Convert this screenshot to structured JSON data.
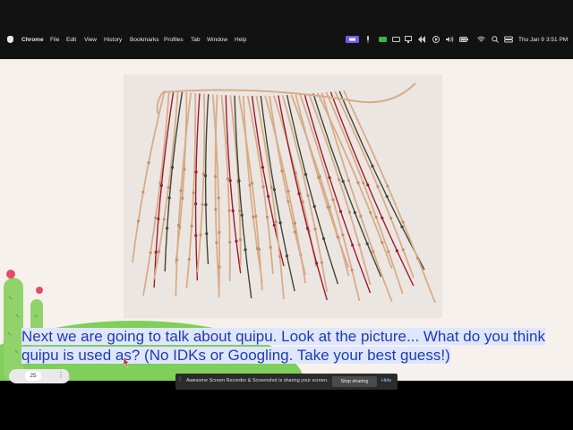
{
  "menubar": {
    "app": "Chrome",
    "items": [
      "File",
      "Edit",
      "View",
      "History",
      "Bookmarks",
      "Profiles",
      "Tab",
      "Window",
      "Help"
    ],
    "date": "Thu Jan 9",
    "time": "3:51 PM"
  },
  "slide": {
    "caption": "Next we are going to talk about quipu. Look at the picture... What do you think quipu is used as? (No IDKs or Googling. Take your best guess!)"
  },
  "page_indicator": {
    "number": "25"
  },
  "share_bar": {
    "message": "Awesome Screen Recorder & Screenshot is sharing your screen.",
    "stop_label": "Stop sharing",
    "hide_label": "Hide"
  },
  "colors": {
    "caption_text": "#1f3bb3",
    "caption_highlight": "#dfe6ff",
    "cord_tan": "#d7ad88",
    "cord_red": "#9e1b2c",
    "cord_dark": "#3d4638",
    "hill_green": "#7fcf5a"
  }
}
